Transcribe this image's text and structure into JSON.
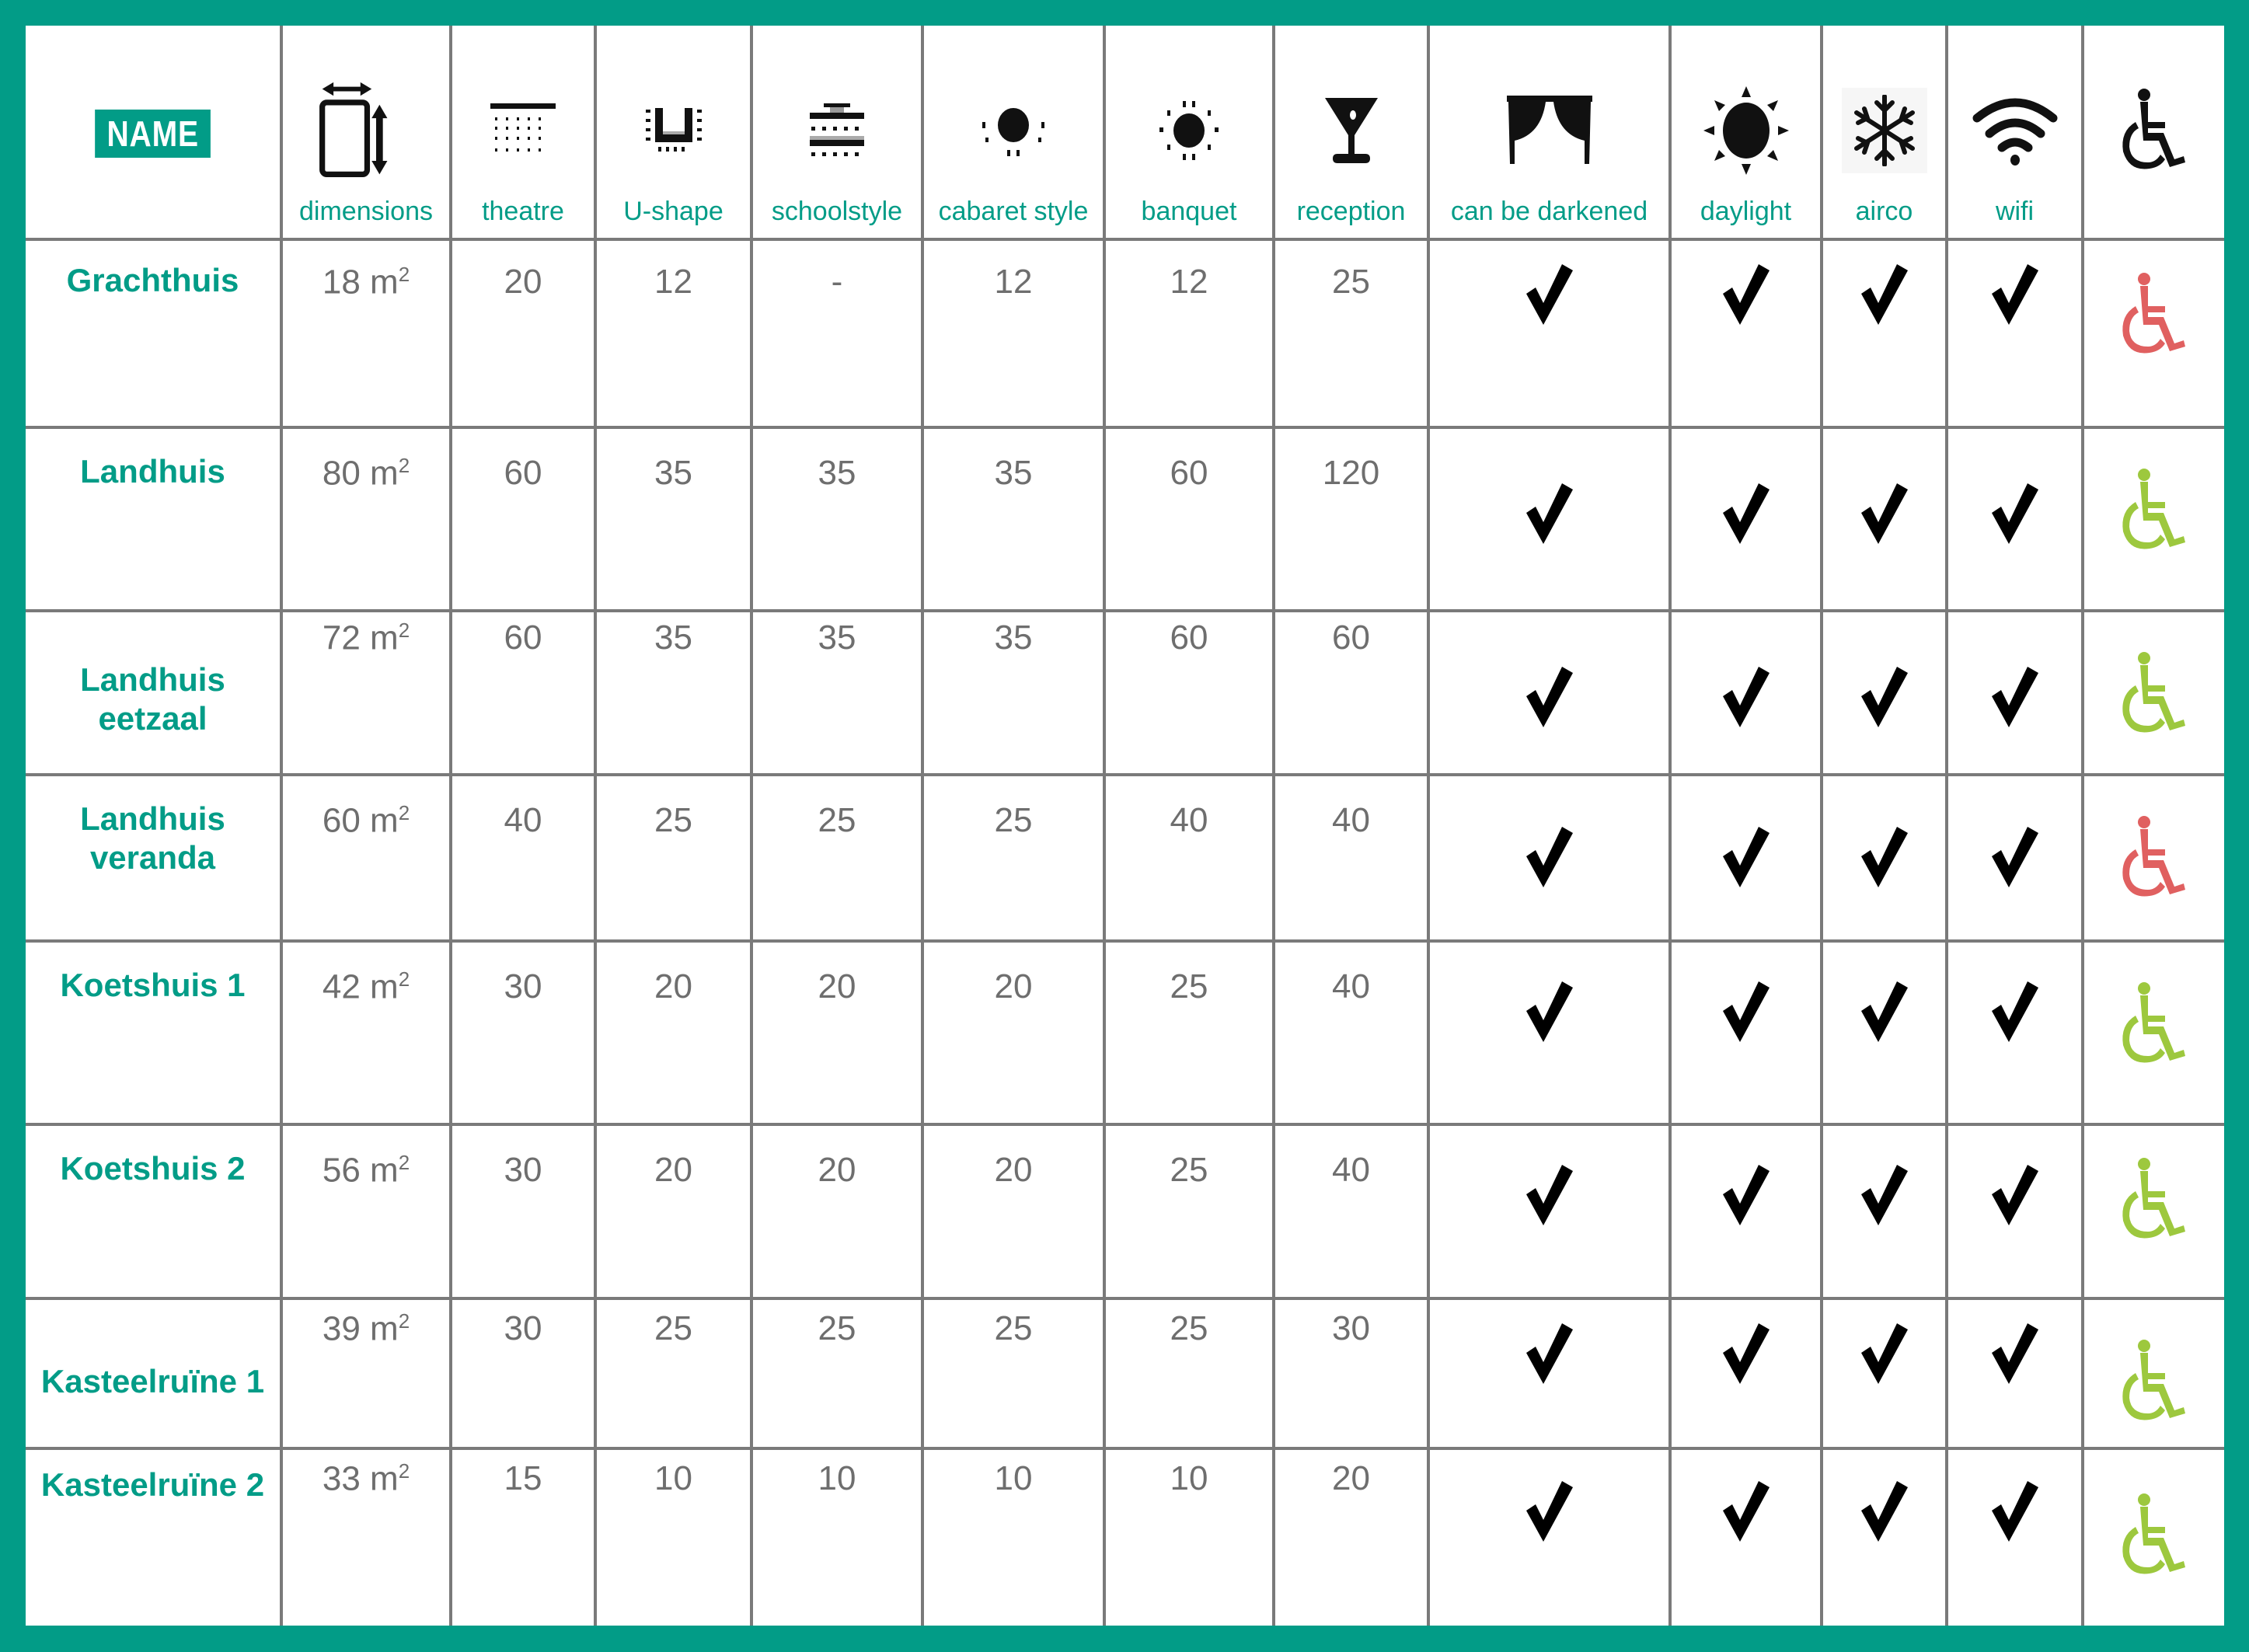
{
  "colors": {
    "brand": "#029c87",
    "accessible": "#9dc83e",
    "not_accessible": "#e06060",
    "grid": "#7a7a7a",
    "value_text": "#6e6e6e"
  },
  "header": {
    "name_label": "NAME",
    "columns": [
      {
        "key": "dimensions",
        "label": "dimensions",
        "icon": "dimensions-icon"
      },
      {
        "key": "theatre",
        "label": "theatre",
        "icon": "theatre-layout-icon"
      },
      {
        "key": "u_shape",
        "label": "U-shape",
        "icon": "u-shape-layout-icon"
      },
      {
        "key": "schoolstyle",
        "label": "schoolstyle",
        "icon": "schoolstyle-layout-icon"
      },
      {
        "key": "cabaret",
        "label": "cabaret style",
        "icon": "cabaret-layout-icon"
      },
      {
        "key": "banquet",
        "label": "banquet",
        "icon": "banquet-layout-icon"
      },
      {
        "key": "reception",
        "label": "reception",
        "icon": "cocktail-glass-icon"
      },
      {
        "key": "darkened",
        "label": "can be darkened",
        "icon": "curtain-icon"
      },
      {
        "key": "daylight",
        "label": "daylight",
        "icon": "sun-icon"
      },
      {
        "key": "airco",
        "label": "airco",
        "icon": "snowflake-icon"
      },
      {
        "key": "wifi",
        "label": "wifi",
        "icon": "wifi-icon"
      },
      {
        "key": "accessible",
        "label": "",
        "icon": "wheelchair-icon"
      }
    ]
  },
  "rows": [
    {
      "name": "Grachthuis",
      "dimensions": "18",
      "unit": "m",
      "exp": "2",
      "theatre": "20",
      "u_shape": "12",
      "schoolstyle": "-",
      "cabaret": "12",
      "banquet": "12",
      "reception": "25",
      "darkened": true,
      "daylight": true,
      "airco": true,
      "wifi": true,
      "accessible": false
    },
    {
      "name": "Landhuis",
      "dimensions": "80",
      "unit": "m",
      "exp": "2",
      "theatre": "60",
      "u_shape": "35",
      "schoolstyle": "35",
      "cabaret": "35",
      "banquet": "60",
      "reception": "120",
      "darkened": true,
      "daylight": true,
      "airco": true,
      "wifi": true,
      "accessible": true
    },
    {
      "name": "Landhuis eetzaal",
      "dimensions": "72",
      "unit": "m",
      "exp": "2",
      "theatre": "60",
      "u_shape": "35",
      "schoolstyle": "35",
      "cabaret": "35",
      "banquet": "60",
      "reception": "60",
      "darkened": true,
      "daylight": true,
      "airco": true,
      "wifi": true,
      "accessible": true
    },
    {
      "name": "Landhuis veranda",
      "dimensions": "60",
      "unit": "m",
      "exp": "2",
      "theatre": "40",
      "u_shape": "25",
      "schoolstyle": "25",
      "cabaret": "25",
      "banquet": "40",
      "reception": "40",
      "darkened": true,
      "daylight": true,
      "airco": true,
      "wifi": true,
      "accessible": false
    },
    {
      "name": "Koetshuis 1",
      "dimensions": "42",
      "unit": "m",
      "exp": "2",
      "theatre": "30",
      "u_shape": "20",
      "schoolstyle": "20",
      "cabaret": "20",
      "banquet": "25",
      "reception": "40",
      "darkened": true,
      "daylight": true,
      "airco": true,
      "wifi": true,
      "accessible": true
    },
    {
      "name": "Koetshuis 2",
      "dimensions": "56",
      "unit": "m",
      "exp": "2",
      "theatre": "30",
      "u_shape": "20",
      "schoolstyle": "20",
      "cabaret": "20",
      "banquet": "25",
      "reception": "40",
      "darkened": true,
      "daylight": true,
      "airco": true,
      "wifi": true,
      "accessible": true
    },
    {
      "name": "Kasteelruïne 1",
      "dimensions": "39",
      "unit": "m",
      "exp": "2",
      "theatre": "30",
      "u_shape": "25",
      "schoolstyle": "25",
      "cabaret": "25",
      "banquet": "25",
      "reception": "30",
      "darkened": true,
      "daylight": true,
      "airco": true,
      "wifi": true,
      "accessible": true
    },
    {
      "name": "Kasteelruïne 2",
      "dimensions": "33",
      "unit": "m",
      "exp": "2",
      "theatre": "15",
      "u_shape": "10",
      "schoolstyle": "10",
      "cabaret": "10",
      "banquet": "10",
      "reception": "20",
      "darkened": true,
      "daylight": true,
      "airco": true,
      "wifi": true,
      "accessible": true
    }
  ]
}
